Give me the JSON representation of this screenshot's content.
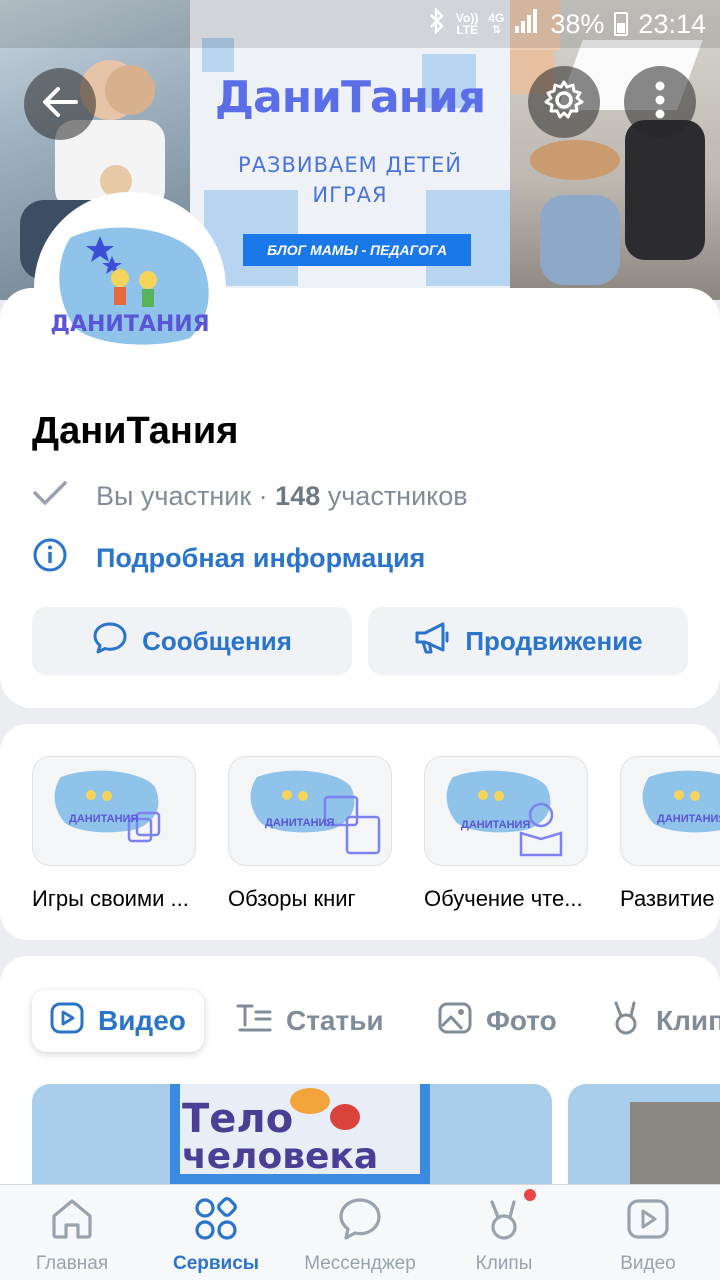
{
  "status": {
    "bluetooth_icon": "bluetooth-icon",
    "volte": "Vo)) LTE",
    "network": "4G",
    "battery": "38%",
    "time": "23:14"
  },
  "cover": {
    "title": "ДаниТания",
    "subtitle_line1": "развиваем детей",
    "subtitle_line2": "играя",
    "badge": "БЛОГ МАМЫ - ПЕДАГОГА"
  },
  "avatar": {
    "logo_text": "ДАНИТАНИЯ"
  },
  "profile": {
    "name": "ДаниТания",
    "member_status": "Вы участник · ",
    "member_count": "148",
    "member_suffix": " участников",
    "info_link": "Подробная информация",
    "messages_button": "Сообщения",
    "promotion_button": "Продвижение"
  },
  "albums": [
    {
      "label": "Игры своими ...",
      "logo": "ДАНИТАНИЯ"
    },
    {
      "label": "Обзоры книг",
      "logo": "ДАНИТАНИЯ"
    },
    {
      "label": "Обучение чте...",
      "logo": "ДАНИТАНИЯ"
    },
    {
      "label": "Развитие",
      "logo": "ДАНИТАНИЯ"
    }
  ],
  "tabs": [
    {
      "label": "Видео",
      "active": true
    },
    {
      "label": "Статьи",
      "active": false
    },
    {
      "label": "Фото",
      "active": false
    },
    {
      "label": "Клипы",
      "active": false
    }
  ],
  "video": {
    "thumb_text_1": "Тело",
    "thumb_text_2": "человека"
  },
  "nav": [
    {
      "label": "Главная",
      "icon": "home-icon"
    },
    {
      "label": "Сервисы",
      "icon": "services-icon"
    },
    {
      "label": "Мессенджер",
      "icon": "messenger-icon"
    },
    {
      "label": "Клипы",
      "icon": "clips-icon"
    },
    {
      "label": "Видео",
      "icon": "video-icon"
    }
  ],
  "colors": {
    "accent": "#2a74c9",
    "notification": "#e64646"
  }
}
